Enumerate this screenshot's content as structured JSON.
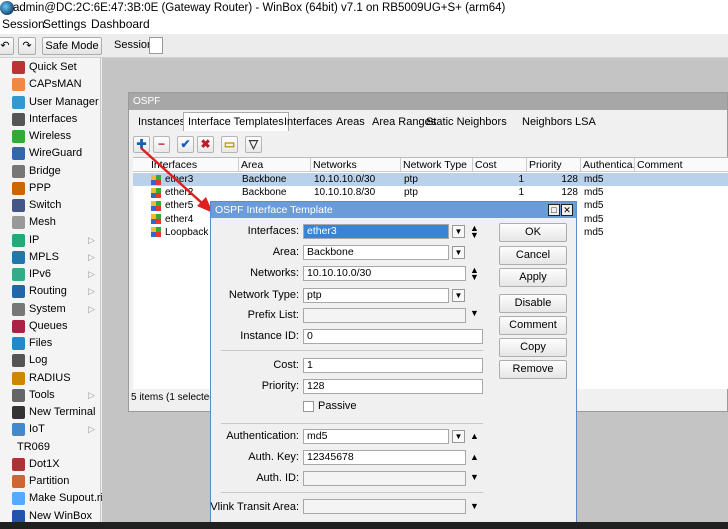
{
  "window": {
    "title": "admin@DC:2C:6E:47:3B:0E (Gateway Router) - WinBox (64bit) v7.1 on RB5009UG+S+ (arm64)"
  },
  "menu": {
    "session": "Session",
    "settings": "Settings",
    "dashboard": "Dashboard"
  },
  "toolbar": {
    "safe_mode": "Safe Mode",
    "session_label": "Session:",
    "session_value": ""
  },
  "sidebar": {
    "items": [
      {
        "label": "Quick Set",
        "icon": "wand-icon",
        "submenu": false
      },
      {
        "label": "CAPsMAN",
        "icon": "antenna-icon",
        "submenu": false
      },
      {
        "label": "User Manager",
        "icon": "users-icon",
        "submenu": false
      },
      {
        "label": "Interfaces",
        "icon": "interfaces-icon",
        "submenu": false
      },
      {
        "label": "Wireless",
        "icon": "wireless-icon",
        "submenu": false
      },
      {
        "label": "WireGuard",
        "icon": "wireguard-icon",
        "submenu": false
      },
      {
        "label": "Bridge",
        "icon": "bridge-icon",
        "submenu": false
      },
      {
        "label": "PPP",
        "icon": "ppp-icon",
        "submenu": false
      },
      {
        "label": "Switch",
        "icon": "switch-icon",
        "submenu": false
      },
      {
        "label": "Mesh",
        "icon": "mesh-icon",
        "submenu": false
      },
      {
        "label": "IP",
        "icon": "ip-icon",
        "submenu": true
      },
      {
        "label": "MPLS",
        "icon": "mpls-icon",
        "submenu": true
      },
      {
        "label": "IPv6",
        "icon": "ipv6-icon",
        "submenu": true
      },
      {
        "label": "Routing",
        "icon": "routing-icon",
        "submenu": true
      },
      {
        "label": "System",
        "icon": "system-icon",
        "submenu": true
      },
      {
        "label": "Queues",
        "icon": "queues-icon",
        "submenu": false
      },
      {
        "label": "Files",
        "icon": "files-icon",
        "submenu": false
      },
      {
        "label": "Log",
        "icon": "log-icon",
        "submenu": false
      },
      {
        "label": "RADIUS",
        "icon": "radius-icon",
        "submenu": false
      },
      {
        "label": "Tools",
        "icon": "tools-icon",
        "submenu": true
      },
      {
        "label": "New Terminal",
        "icon": "terminal-icon",
        "submenu": false
      },
      {
        "label": "IoT",
        "icon": "iot-icon",
        "submenu": true
      },
      {
        "label": "TR069",
        "icon": "",
        "submenu": false
      },
      {
        "label": "Dot1X",
        "icon": "dot1x-icon",
        "submenu": false
      },
      {
        "label": "Partition",
        "icon": "partition-icon",
        "submenu": false
      },
      {
        "label": "Make Supout.rif",
        "icon": "supout-icon",
        "submenu": false
      },
      {
        "label": "New WinBox",
        "icon": "winbox-icon",
        "submenu": false
      }
    ]
  },
  "ospf": {
    "title": "OSPF",
    "tabs": [
      "Instances",
      "Interface Templates",
      "Interfaces",
      "Areas",
      "Area Ranges",
      "Static Neighbors",
      "Neighbors",
      "LSA"
    ],
    "active_tab": "Interface Templates",
    "columns": [
      "Interfaces",
      "Area",
      "Networks",
      "Network Type",
      "Cost",
      "Priority",
      "Authentica...",
      "Comment"
    ],
    "rows": [
      {
        "iface": "ether3",
        "area": "Backbone",
        "networks": "10.10.10.0/30",
        "type": "ptp",
        "cost": "1",
        "priority": "128",
        "auth": "md5",
        "selected": true
      },
      {
        "iface": "ether2",
        "area": "Backbone",
        "networks": "10.10.10.8/30",
        "type": "ptp",
        "cost": "1",
        "priority": "128",
        "auth": "md5",
        "selected": false
      },
      {
        "iface": "ether5",
        "area": "",
        "networks": "",
        "type": "",
        "cost": "",
        "priority": "",
        "auth": "md5",
        "selected": false
      },
      {
        "iface": "ether4",
        "area": "",
        "networks": "",
        "type": "",
        "cost": "",
        "priority": "",
        "auth": "md5",
        "selected": false
      },
      {
        "iface": "Loopback",
        "area": "",
        "networks": "",
        "type": "",
        "cost": "",
        "priority": "",
        "auth": "md5",
        "selected": false
      }
    ],
    "status": "5 items (1 selected)"
  },
  "dialog": {
    "title": "OSPF Interface Template",
    "fields": {
      "interfaces_label": "Interfaces:",
      "interfaces_value": "ether3",
      "area_label": "Area:",
      "area_value": "Backbone",
      "networks_label": "Networks:",
      "networks_value": "10.10.10.0/30",
      "network_type_label": "Network Type:",
      "network_type_value": "ptp",
      "prefix_list_label": "Prefix List:",
      "prefix_list_value": "",
      "instance_id_label": "Instance ID:",
      "instance_id_value": "0",
      "cost_label": "Cost:",
      "cost_value": "1",
      "priority_label": "Priority:",
      "priority_value": "128",
      "passive_label": "Passive",
      "passive_checked": false,
      "authentication_label": "Authentication:",
      "authentication_value": "md5",
      "auth_key_label": "Auth. Key:",
      "auth_key_value": "12345678",
      "auth_id_label": "Auth. ID:",
      "auth_id_value": "",
      "vlink_label": "Vlink Transit Area:",
      "vlink_value": ""
    },
    "buttons": {
      "ok": "OK",
      "cancel": "Cancel",
      "apply": "Apply",
      "disable": "Disable",
      "comment": "Comment",
      "copy": "Copy",
      "remove": "Remove"
    }
  },
  "colors": {
    "accent": "#6b9bd8",
    "selection": "#b9d1ea",
    "arrow": "#e02020"
  }
}
